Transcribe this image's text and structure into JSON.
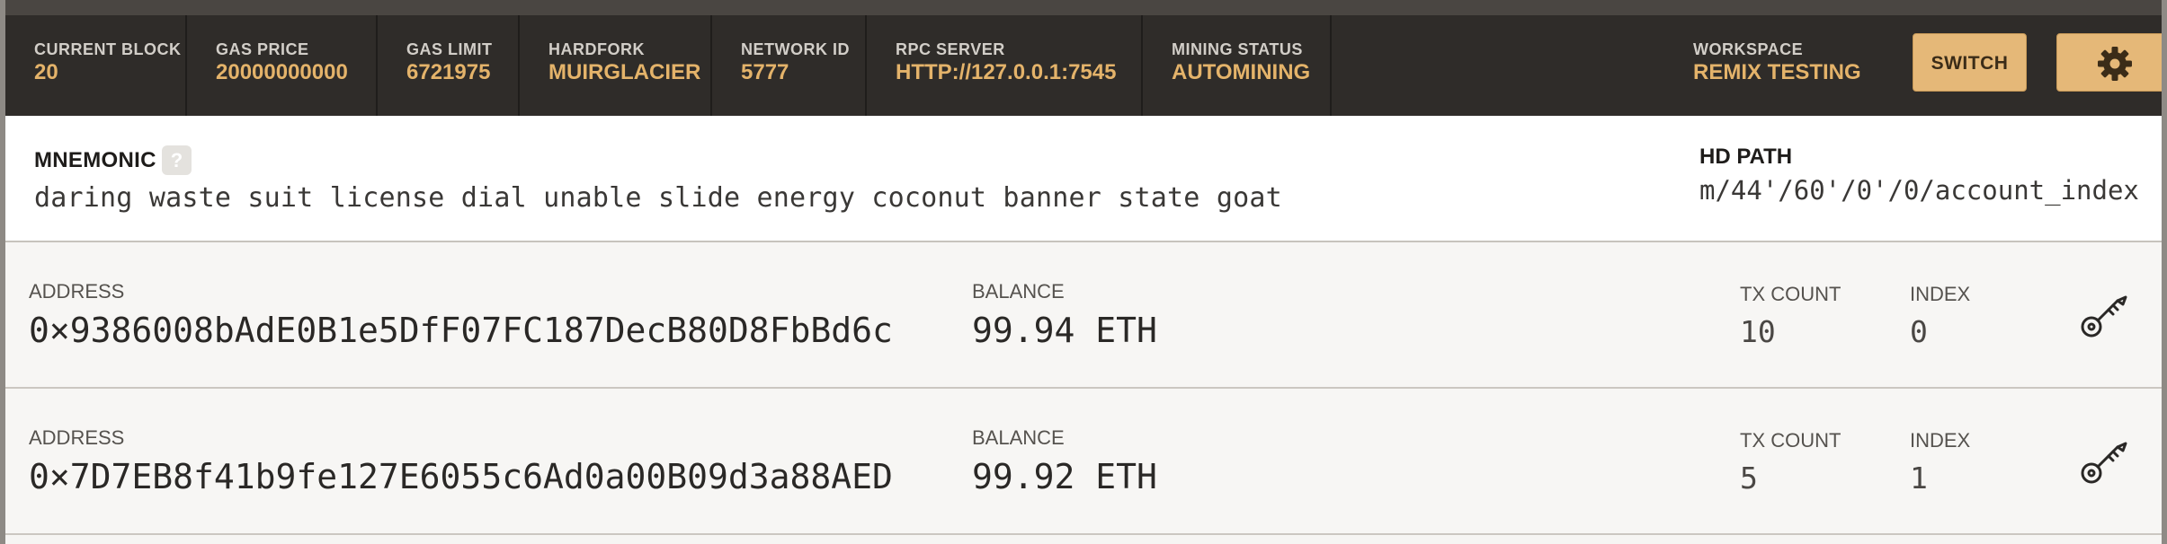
{
  "status_bar": {
    "stats": [
      {
        "label": "CURRENT BLOCK",
        "value": "20"
      },
      {
        "label": "GAS PRICE",
        "value": "20000000000"
      },
      {
        "label": "GAS LIMIT",
        "value": "6721975"
      },
      {
        "label": "HARDFORK",
        "value": "MUIRGLACIER"
      },
      {
        "label": "NETWORK ID",
        "value": "5777"
      },
      {
        "label": "RPC SERVER",
        "value": "HTTP://127.0.0.1:7545"
      },
      {
        "label": "MINING STATUS",
        "value": "AUTOMINING"
      }
    ],
    "workspace": {
      "label": "WORKSPACE",
      "value": "REMIX TESTING"
    },
    "switch_label": "SWITCH",
    "settings_icon": "gear-icon"
  },
  "mnemonic": {
    "label": "MNEMONIC",
    "help": "?",
    "words": "daring waste suit license dial unable slide energy coconut banner state goat",
    "hd_path_label": "HD PATH",
    "hd_path": "m/44'/60'/0'/0/account_index"
  },
  "accounts": {
    "address_label": "ADDRESS",
    "balance_label": "BALANCE",
    "tx_count_label": "TX COUNT",
    "index_label": "INDEX",
    "key_icon": "key-icon",
    "rows": [
      {
        "address": "0×9386008bAdE0B1e5DfF07FC187DecB80D8FbBd6c",
        "balance": "99.94 ETH",
        "tx_count": "10",
        "index": "0"
      },
      {
        "address": "0×7D7EB8f41b9fe127E6055c6Ad0a00B09d3a88AED",
        "balance": "99.92 ETH",
        "tx_count": "5",
        "index": "1"
      }
    ]
  },
  "colors": {
    "status_bg": "#2f2c29",
    "accent": "#e4b36a",
    "button_bg": "#e5b878"
  }
}
